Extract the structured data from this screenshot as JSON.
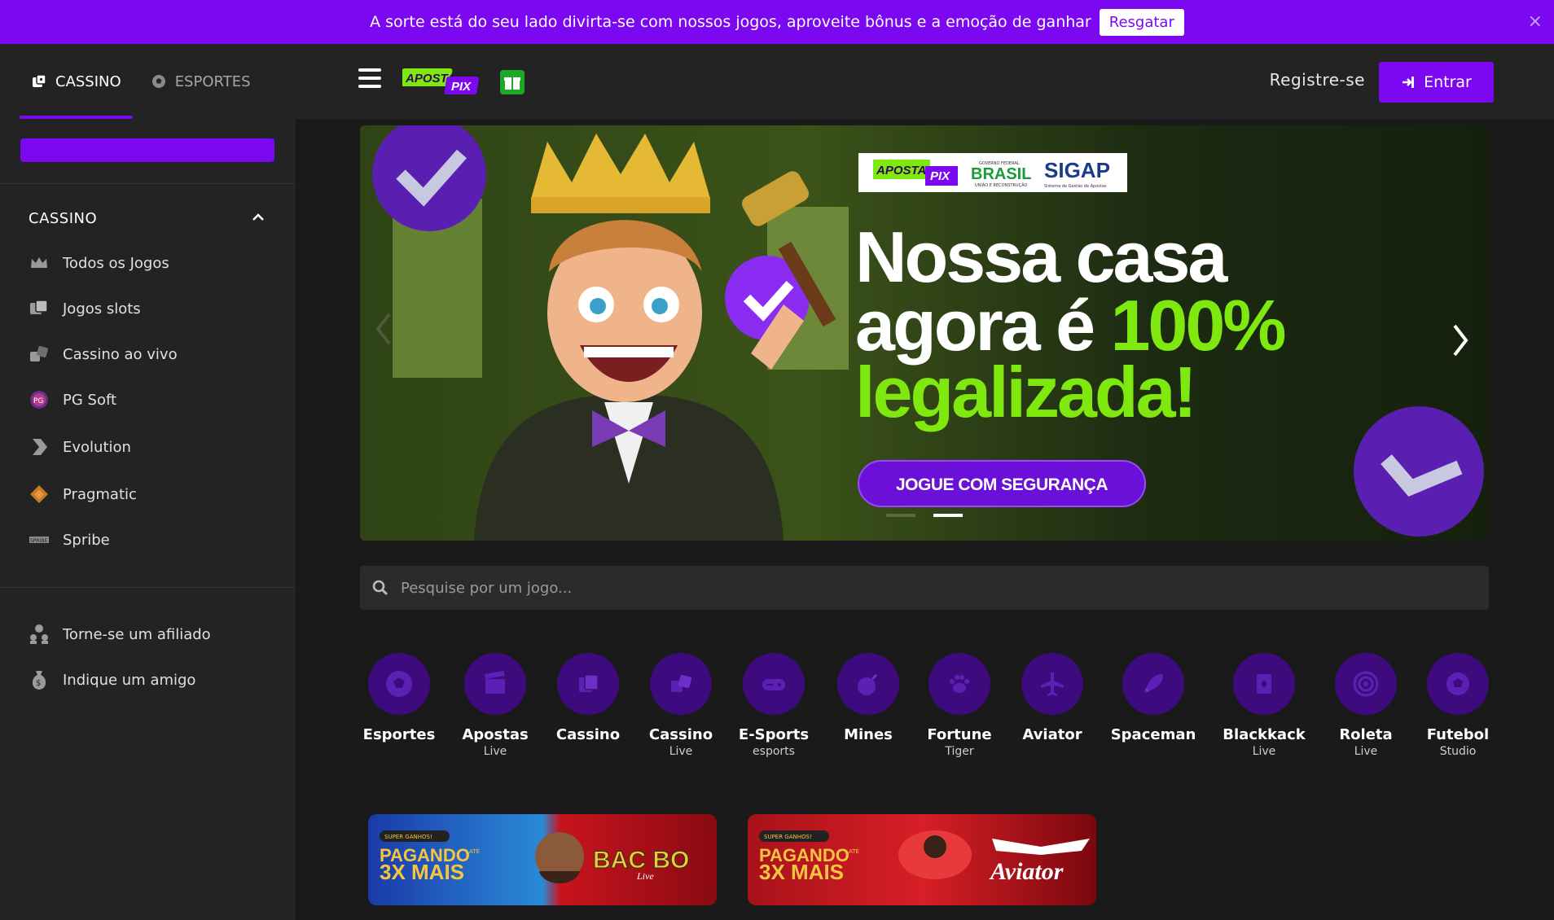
{
  "promo_bar": {
    "text": "A sorte está do seu lado divirta-se com nossos jogos, aproveite bônus e a emoção de ganhar",
    "button": "Resgatar",
    "close": "×"
  },
  "header": {
    "tabs": [
      {
        "label": "CASSINO",
        "icon": "casino-icon",
        "active": true
      },
      {
        "label": "ESPORTES",
        "icon": "soccer-ball-icon",
        "active": false
      }
    ],
    "logo_text_1": "APOSTA",
    "logo_text_2": "PIX",
    "register": "Registre-se",
    "login": "Entrar"
  },
  "sidebar": {
    "section_title": "CASSINO",
    "items": [
      {
        "label": "Todos os Jogos",
        "icon": "crown-icon"
      },
      {
        "label": "Jogos slots",
        "icon": "slots-icon"
      },
      {
        "label": "Cassino ao vivo",
        "icon": "dice-icon"
      },
      {
        "label": "PG Soft",
        "icon": "pg-soft-icon"
      },
      {
        "label": "Evolution",
        "icon": "evolution-icon"
      },
      {
        "label": "Pragmatic",
        "icon": "pragmatic-icon"
      },
      {
        "label": "Spribe",
        "icon": "spribe-icon"
      }
    ],
    "extras": [
      {
        "label": "Torne-se um afiliado",
        "icon": "affiliate-icon"
      },
      {
        "label": "Indique um amigo",
        "icon": "money-bag-icon"
      }
    ]
  },
  "banner": {
    "headline_1": "Nossa casa",
    "headline_2a": "agora é ",
    "headline_2b": "100%",
    "headline_3": "legalizada!",
    "cta": "JOGUE COM SEGURANÇA",
    "partner_logo_1a": "APOSTA",
    "partner_logo_1b": "PIX",
    "partner_logo_2_top": "GOVERNO FEDERAL",
    "partner_logo_2": "BRASIL",
    "partner_logo_2_sub": "UNIÃO E RECONSTRUÇÃO",
    "partner_logo_3": "SIGAP",
    "partner_logo_3_sub": "Sistema de Gestão de Apostas"
  },
  "search": {
    "placeholder": "Pesquise por um jogo..."
  },
  "categories": [
    {
      "label": "Esportes",
      "sub": "",
      "icon": "soccer-ball-icon"
    },
    {
      "label": "Apostas",
      "sub": "Live",
      "icon": "clapperboard-icon"
    },
    {
      "label": "Cassino",
      "sub": "",
      "icon": "cards-icon"
    },
    {
      "label": "Cassino",
      "sub": "Live",
      "icon": "dice-icon"
    },
    {
      "label": "E-Sports",
      "sub": "esports",
      "icon": "gamepad-icon"
    },
    {
      "label": "Mines",
      "sub": "",
      "icon": "bomb-icon"
    },
    {
      "label": "Fortune",
      "sub": "Tiger",
      "icon": "paw-icon"
    },
    {
      "label": "Aviator",
      "sub": "",
      "icon": "plane-icon"
    },
    {
      "label": "Spaceman",
      "sub": "",
      "icon": "rocket-icon"
    },
    {
      "label": "Blackkack",
      "sub": "Live",
      "icon": "card-icon"
    },
    {
      "label": "Roleta",
      "sub": "Live",
      "icon": "roulette-icon"
    },
    {
      "label": "Futebol",
      "sub": "Studio",
      "icon": "football-icon"
    }
  ],
  "promo_cards": [
    {
      "badge": "SUPER GANHOS!",
      "line1": "PAGANDO",
      "upto": "ATÉ",
      "line2": "3X MAIS",
      "game": "BAC BO",
      "game_sub": "Live"
    },
    {
      "badge": "SUPER GANHOS!",
      "line1": "PAGANDO",
      "upto": "ATÉ",
      "line2": "3X MAIS",
      "game": "Aviator",
      "game_sub": ""
    }
  ],
  "colors": {
    "accent": "#7c08f2",
    "lime": "#7ee80f",
    "category_circle": "#3e0b7e"
  }
}
